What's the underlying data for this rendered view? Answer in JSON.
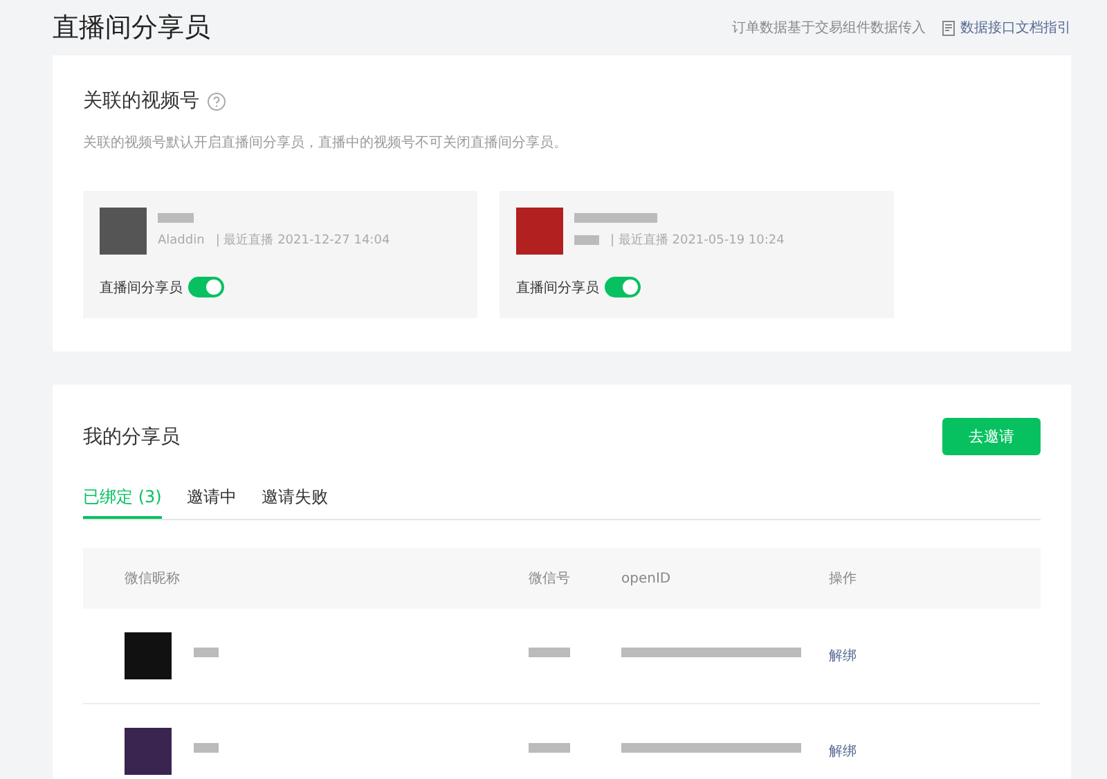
{
  "page_title": "直播间分享员",
  "header_note": "订单数据基于交易组件数据传入",
  "doc_link": "数据接口文档指引",
  "linked": {
    "title": "关联的视频号",
    "description": "关联的视频号默认开启直播间分享员，直播中的视频号不可关闭直播间分享员。",
    "accounts": [
      {
        "meta_prefix": "Aladdin",
        "meta": "| 最近直播 2021-12-27 14:04",
        "toggle_label": "直播间分享员",
        "on": true
      },
      {
        "meta": "| 最近直播 2021-05-19 10:24",
        "toggle_label": "直播间分享员",
        "on": true
      }
    ]
  },
  "sharers": {
    "title": "我的分享员",
    "invite_button": "去邀请",
    "tabs": [
      {
        "label": "已绑定 (3)",
        "selected": true
      },
      {
        "label": "邀请中",
        "selected": false
      },
      {
        "label": "邀请失败",
        "selected": false
      }
    ],
    "table": {
      "columns": [
        "微信昵称",
        "微信号",
        "openID",
        "操作"
      ],
      "rows": [
        {
          "action": "解绑"
        },
        {
          "action": "解绑"
        }
      ]
    }
  }
}
